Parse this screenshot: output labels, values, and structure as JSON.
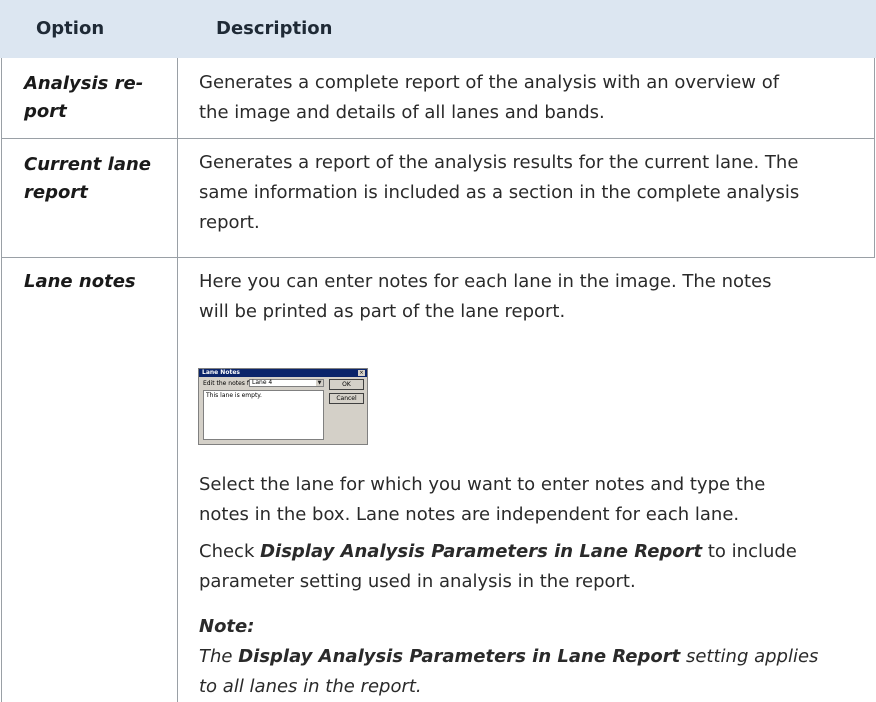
{
  "table": {
    "headers": {
      "option": "Option",
      "description": "Description"
    },
    "rows": [
      {
        "option_line1": "Analysis re-",
        "option_line2": "port",
        "desc_line1": "Generates a complete report of the analysis with an overview of",
        "desc_line2": "the image and details of all lanes and bands."
      },
      {
        "option_line1": "Current lane",
        "option_line2": "report",
        "desc_line1": "Generates a report of the analysis results for the current lane. The",
        "desc_line2": "same information is included as a section in the complete analysis",
        "desc_line3": "report."
      },
      {
        "option_line1": "Lane notes",
        "desc_line1": "Here you can enter notes for each lane in the image. The notes",
        "desc_line2": "will be printed as part of the lane report.",
        "para2_line1": "Select the lane for which you want to enter notes and type the",
        "para2_line2": "notes in the box. Lane notes are independent for each lane.",
        "para3_pre": "Check ",
        "para3_bold": "Display Analysis Parameters in Lane Report",
        "para3_post": " to include",
        "para3_line2": "parameter setting used in analysis in the report.",
        "note_heading": "Note:",
        "note_pre": "The ",
        "note_bold": "Display Analysis Parameters in Lane Report",
        "note_post": " setting applies",
        "note_line2": "to all lanes in the report."
      }
    ]
  },
  "dialog": {
    "title": "Lane Notes",
    "close_glyph": "×",
    "label": "Edit the notes for:",
    "combo_value": "Lane 4",
    "combo_arrow": "▼",
    "text_value": "This lane is empty.",
    "ok_label": "OK",
    "cancel_label": "Cancel"
  }
}
